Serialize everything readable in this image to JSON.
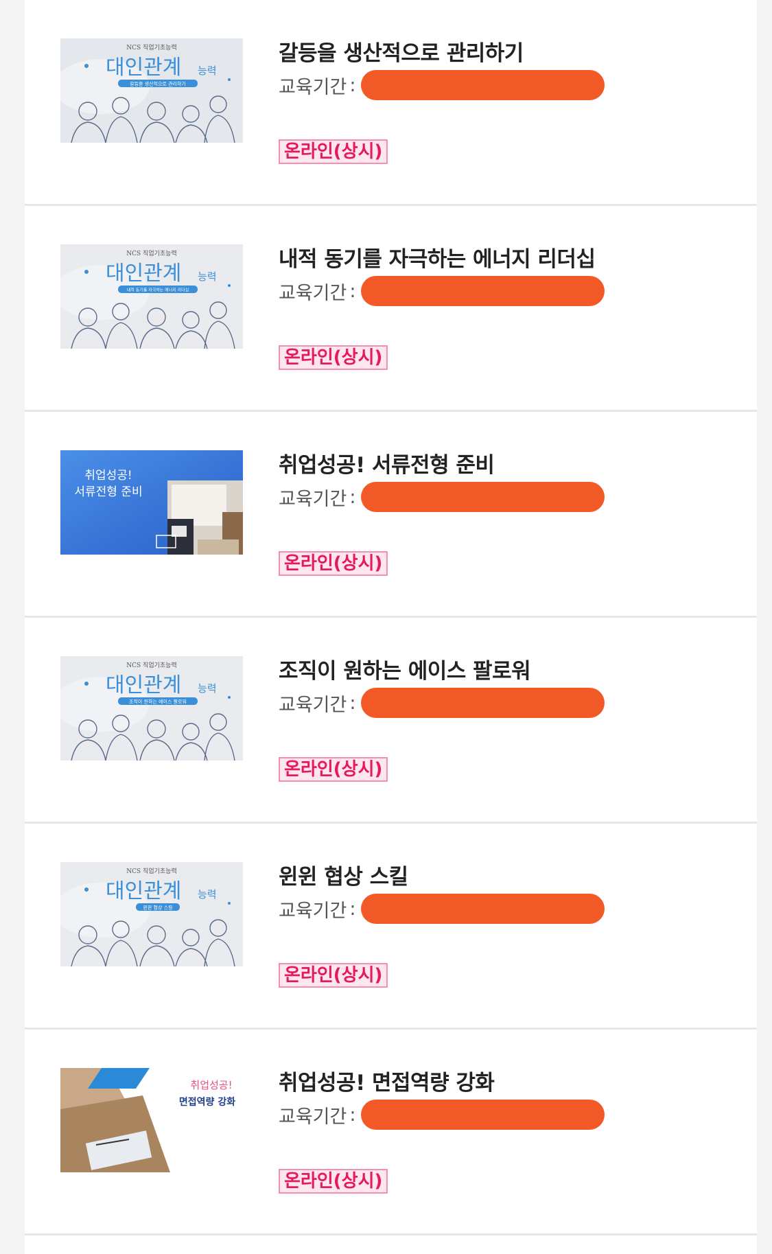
{
  "period_label": "교육기간",
  "period_colon": ":",
  "courses": [
    {
      "title": "갈등을 생산적으로 관리하기",
      "period_value": "",
      "badge": "온라인(상시)",
      "thumb": {
        "kind": "ncs",
        "top_text": "NCS 직업기초능력",
        "main_text_1": "대인관계",
        "main_text_2": "능력",
        "subtitle": "갈등을 생산적으로 관리하기"
      }
    },
    {
      "title": "내적 동기를 자극하는 에너지 리더십",
      "period_value": "",
      "badge": "온라인(상시)",
      "thumb": {
        "kind": "ncs",
        "top_text": "NCS 직업기초능력",
        "main_text_1": "대인관계",
        "main_text_2": "능력",
        "subtitle": "내적 동기를 자극하는 에너지 리더십"
      }
    },
    {
      "title": "취업성공! 서류전형 준비",
      "period_value": "",
      "badge": "온라인(상시)",
      "thumb": {
        "kind": "doc",
        "line1": "취업성공!",
        "line2": "서류전형 준비"
      }
    },
    {
      "title": "조직이 원하는 에이스 팔로워",
      "period_value": "",
      "badge": "온라인(상시)",
      "thumb": {
        "kind": "ncs",
        "top_text": "NCS 직업기초능력",
        "main_text_1": "대인관계",
        "main_text_2": "능력",
        "subtitle": "조직이 원하는 에이스 팔로워"
      }
    },
    {
      "title": "윈윈 협상 스킬",
      "period_value": "",
      "badge": "온라인(상시)",
      "thumb": {
        "kind": "ncs",
        "top_text": "NCS 직업기초능력",
        "main_text_1": "대인관계",
        "main_text_2": "능력",
        "subtitle": "윈윈 협상 스킬"
      }
    },
    {
      "title": "취업성공! 면접역량 강화",
      "period_value": "",
      "badge": "온라인(상시)",
      "thumb": {
        "kind": "interview",
        "line1": "취업성공!",
        "line2": "면접역량 강화"
      }
    }
  ],
  "colors": {
    "redaction": "#f15a26",
    "badge_text": "#e5195e",
    "badge_bg": "#fde6ee",
    "badge_border": "#f48fb1",
    "title": "#222222",
    "ncs_blue": "#3a8fd8",
    "doc_blue": "#3b7be0"
  }
}
